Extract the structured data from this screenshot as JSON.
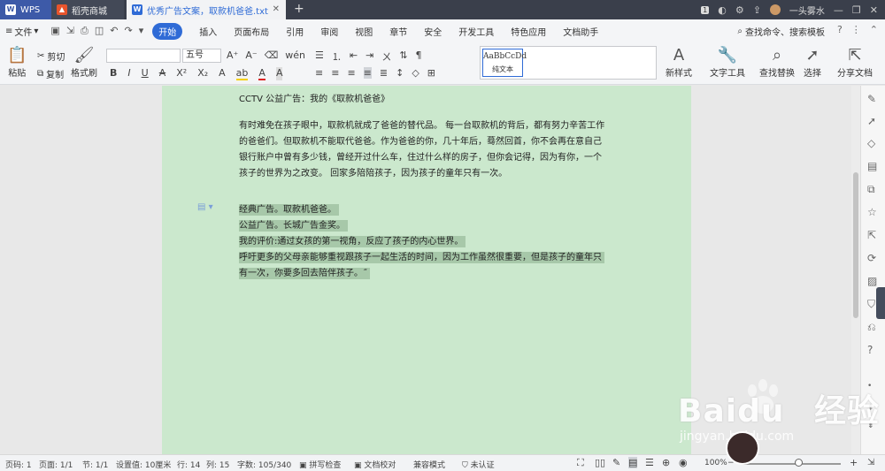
{
  "tabs": [
    {
      "label": "WPS"
    },
    {
      "label": "稻壳商城"
    },
    {
      "label": "优秀广告文案，取款机爸爸.txt"
    }
  ],
  "title_bar": {
    "user": "一头雾水",
    "badge": "1"
  },
  "menu": {
    "file": "文件",
    "items": [
      "开始",
      "插入",
      "页面布局",
      "引用",
      "审阅",
      "视图",
      "章节",
      "安全",
      "开发工具",
      "特色应用",
      "文档助手"
    ],
    "search": "查找命令、搜索模板"
  },
  "ribbon": {
    "paste": "粘贴",
    "cut": "剪切",
    "copy": "复制",
    "format_painter": "格式刷",
    "font_name": "",
    "font_size": "五号",
    "style_sample": "AaBbCcDd",
    "style_label": "纯文本",
    "new_style": "新样式",
    "text_tools": "文字工具",
    "find_replace": "查找替换",
    "select": "选择",
    "share": "分享文档"
  },
  "document": {
    "lines": [
      "CCTV 公益广告：我的《取款机爸爸》",
      "有时难免在孩子眼中，取款机就成了爸爸的替代品。 每一台取款机的背后，都有努力辛苦工作",
      "的爸爸们。但取款机不能取代爸爸。作为爸爸的你，几十年后，蓦然回首，你不会再在意自己",
      "银行账户中曾有多少钱，曾经开过什么车，住过什么样的房子，但你会记得，因为有你，一个",
      "孩子的世界为之改变。 回家多陪陪孩子，因为孩子的童年只有一次。"
    ],
    "highlighted": [
      "经典广告。取款机爸爸。",
      "公益广告。长城广告金奖。",
      "我的评价:通过女孩的第一视角，反应了孩子的内心世界。",
      "呼吁更多的父母亲能够重视跟孩子一起生活的时间，因为工作虽然很重要，但是孩子的童年只",
      "有一次，你要多回去陪伴孩子。˝"
    ]
  },
  "status": {
    "page_no": "页码: 1",
    "pages": "页面: 1/1",
    "section": "节: 1/1",
    "setting": "设置值: 10厘米",
    "row": "行: 14",
    "col": "列: 15",
    "words": "字数: 105/340",
    "spell": "拼写检查",
    "proof": "文档校对",
    "compat": "兼容模式",
    "auth": "未认证",
    "zoom": "100%"
  },
  "watermark": {
    "brand": "Baidu",
    "brand_cn": "经验",
    "url": "jingyan.baidu.com"
  },
  "colors": {
    "accent": "#2f6bd6",
    "page_bg": "#cbe8cd",
    "highlight": "#a7c8a9",
    "tab_bar": "#3a3f4b"
  }
}
